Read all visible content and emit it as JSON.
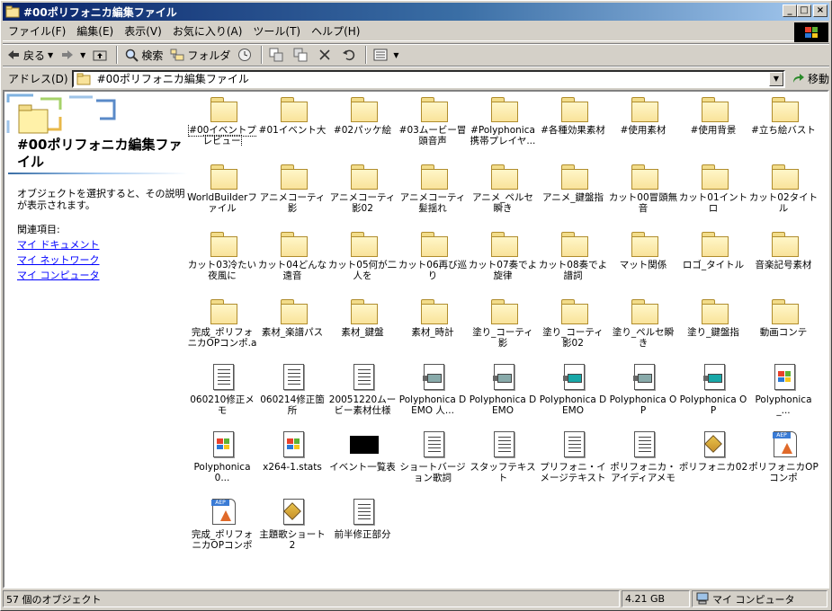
{
  "window": {
    "title": "#00ポリフォニカ編集ファイル",
    "minimize": "_",
    "maximize": "□",
    "close": "×"
  },
  "menu": [
    "ファイル(F)",
    "編集(E)",
    "表示(V)",
    "お気に入り(A)",
    "ツール(T)",
    "ヘルプ(H)"
  ],
  "toolbar": {
    "back": "戻る",
    "search": "検索",
    "folders": "フォルダ"
  },
  "address": {
    "label": "アドレス(D)",
    "value": "#00ポリフォニカ編集ファイル",
    "go": "移動"
  },
  "left_pane": {
    "title": "#00ポリフォニカ編集ファイル",
    "description": "オブジェクトを選択すると、その説明が表示されます。",
    "related_label": "関連項目:",
    "links": [
      "マイ ドキュメント",
      "マイ ネットワーク",
      "マイ コンピュータ"
    ]
  },
  "items": [
    {
      "label": "#00イベントプレビュー",
      "type": "folder",
      "selected": true
    },
    {
      "label": "#01イベント大",
      "type": "folder"
    },
    {
      "label": "#02パッケ絵",
      "type": "folder"
    },
    {
      "label": "#03ムービー冒頭音声",
      "type": "folder"
    },
    {
      "label": "#Polyphonica携帯プレイヤ...",
      "type": "folder"
    },
    {
      "label": "#各種効果素材",
      "type": "folder"
    },
    {
      "label": "#使用素材",
      "type": "folder"
    },
    {
      "label": "#使用背景",
      "type": "folder"
    },
    {
      "label": "#立ち絵バスト",
      "type": "folder"
    },
    {
      "label": "WorldBuilderファイル",
      "type": "folder"
    },
    {
      "label": "アニメコーティ影",
      "type": "folder"
    },
    {
      "label": "アニメコーティ影02",
      "type": "folder"
    },
    {
      "label": "アニメコーティ髪揺れ",
      "type": "folder"
    },
    {
      "label": "アニメ_ペルセ瞬き",
      "type": "folder"
    },
    {
      "label": "アニメ_鍵盤指",
      "type": "folder"
    },
    {
      "label": "カット00冒頭無音",
      "type": "folder"
    },
    {
      "label": "カット01イントロ",
      "type": "folder"
    },
    {
      "label": "カット02タイトル",
      "type": "folder"
    },
    {
      "label": "カット03冷たい夜風に",
      "type": "folder"
    },
    {
      "label": "カット04どんな遠音",
      "type": "folder"
    },
    {
      "label": "カット05何が二人を",
      "type": "folder"
    },
    {
      "label": "カット06再び巡り",
      "type": "folder"
    },
    {
      "label": "カット07奏でよ旋律",
      "type": "folder"
    },
    {
      "label": "カット08奏でよ譜詞",
      "type": "folder"
    },
    {
      "label": "マット関係",
      "type": "folder"
    },
    {
      "label": "ロゴ_タイトル",
      "type": "folder"
    },
    {
      "label": "音楽記号素材",
      "type": "folder"
    },
    {
      "label": "完成_ポリフォニカOPコンポ.ae...",
      "type": "folder"
    },
    {
      "label": "素材_楽譜パス",
      "type": "folder"
    },
    {
      "label": "素材_鍵盤",
      "type": "folder"
    },
    {
      "label": "素材_時計",
      "type": "folder"
    },
    {
      "label": "塗り_コーティ影",
      "type": "folder"
    },
    {
      "label": "塗り_コーティ影02",
      "type": "folder"
    },
    {
      "label": "塗り_ペルセ瞬き",
      "type": "folder"
    },
    {
      "label": "塗り_鍵盤指",
      "type": "folder"
    },
    {
      "label": "動画コンテ",
      "type": "folder"
    },
    {
      "label": "060210修正メモ",
      "type": "text"
    },
    {
      "label": "060214修正箇所",
      "type": "text"
    },
    {
      "label": "20051220ムービー素材仕様",
      "type": "text"
    },
    {
      "label": "Polyphonica DEMO 人...",
      "type": "video"
    },
    {
      "label": "Polyphonica DEMO",
      "type": "video"
    },
    {
      "label": "Polyphonica DEMO",
      "type": "video-teal"
    },
    {
      "label": "Polyphonica OP",
      "type": "video"
    },
    {
      "label": "Polyphonica OP",
      "type": "video-teal"
    },
    {
      "label": "Polyphonica_...",
      "type": "win"
    },
    {
      "label": "Polyphonica0...",
      "type": "win"
    },
    {
      "label": "x264-1.stats",
      "type": "win"
    },
    {
      "label": "イベント一覧表",
      "type": "black"
    },
    {
      "label": "ショートバージョン歌詞",
      "type": "text"
    },
    {
      "label": "スタッフテキスト",
      "type": "text"
    },
    {
      "label": "プリフォニ・イメージテキスト",
      "type": "text"
    },
    {
      "label": "ポリフォニカ・アイディアメモ",
      "type": "text"
    },
    {
      "label": "ポリフォニカ02",
      "type": "pen"
    },
    {
      "label": "ポリフォニカOPコンポ",
      "type": "aep"
    },
    {
      "label": "完成_ポリフォニカOPコンポ",
      "type": "aep"
    },
    {
      "label": "主題歌ショート2",
      "type": "pen"
    },
    {
      "label": "前半修正部分",
      "type": "text"
    }
  ],
  "status": {
    "count": "57 個のオブジェクト",
    "size": "4.21 GB",
    "location": "マイ コンピュータ"
  },
  "colors": {
    "title_start": "#0a246a",
    "title_end": "#a6caf0",
    "link": "#0000ff",
    "folder": "#f9e39a"
  }
}
